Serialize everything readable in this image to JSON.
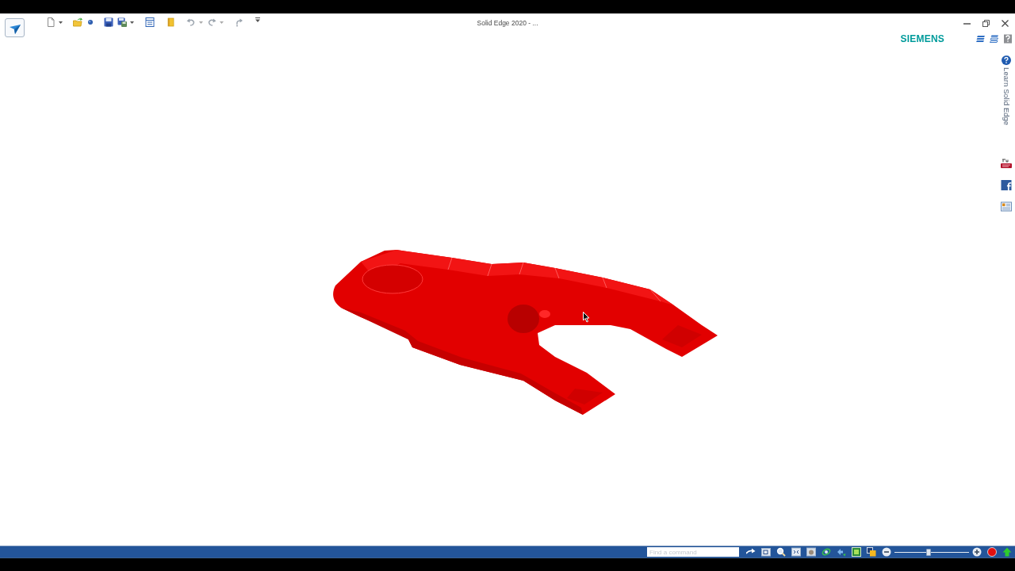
{
  "title_bar": {
    "title": "Solid Edge 2020 - ..."
  },
  "brand": {
    "name": "SIEMENS"
  },
  "side_panel": {
    "learn_tab": "Learn Solid Edge"
  },
  "status_bar": {
    "command_search": {
      "placeholder": "Find a command"
    },
    "zoom_slider": {
      "level": 0.46
    }
  }
}
